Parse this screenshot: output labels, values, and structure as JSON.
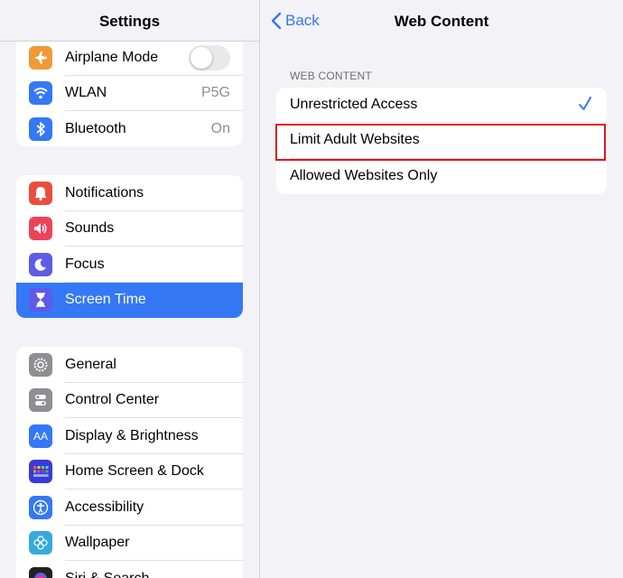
{
  "sidebar": {
    "title": "Settings",
    "group1": [
      {
        "label": "Airplane Mode",
        "icon": "airplane-icon",
        "color": "#f09a37",
        "control": "toggle",
        "toggle_on": false
      },
      {
        "label": "WLAN",
        "icon": "wifi-icon",
        "color": "#3478f6",
        "value": "P5G"
      },
      {
        "label": "Bluetooth",
        "icon": "bluetooth-icon",
        "color": "#3478f6",
        "value": "On"
      }
    ],
    "group2": [
      {
        "label": "Notifications",
        "icon": "bell-icon",
        "color": "#eb4d3d"
      },
      {
        "label": "Sounds",
        "icon": "speaker-icon",
        "color": "#eb445a"
      },
      {
        "label": "Focus",
        "icon": "moon-icon",
        "color": "#5e5ce6"
      },
      {
        "label": "Screen Time",
        "icon": "hourglass-icon",
        "color": "#5e5ce6",
        "active": true
      }
    ],
    "group3": [
      {
        "label": "General",
        "icon": "gear-icon",
        "color": "#8e8e93"
      },
      {
        "label": "Control Center",
        "icon": "switches-icon",
        "color": "#8e8e93"
      },
      {
        "label": "Display & Brightness",
        "icon": "text-size-icon",
        "color": "#3478f6",
        "icon_text": "AA"
      },
      {
        "label": "Home Screen & Dock",
        "icon": "app-grid-icon",
        "color": "#3a3ad9"
      },
      {
        "label": "Accessibility",
        "icon": "accessibility-icon",
        "color": "#3478f6"
      },
      {
        "label": "Wallpaper",
        "icon": "flower-icon",
        "color": "#36aadc"
      },
      {
        "label": "Siri & Search",
        "icon": "siri-icon",
        "color": "#222222"
      }
    ]
  },
  "detail": {
    "back_label": "Back",
    "title": "Web Content",
    "section_label": "WEB CONTENT",
    "options": [
      {
        "label": "Unrestricted Access",
        "selected": true
      },
      {
        "label": "Limit Adult Websites",
        "selected": false,
        "highlighted": true
      },
      {
        "label": "Allowed Websites Only",
        "selected": false
      }
    ]
  },
  "colors": {
    "accent": "#3478f6",
    "highlight_border": "#e0141e",
    "background": "#f2f2f7"
  }
}
